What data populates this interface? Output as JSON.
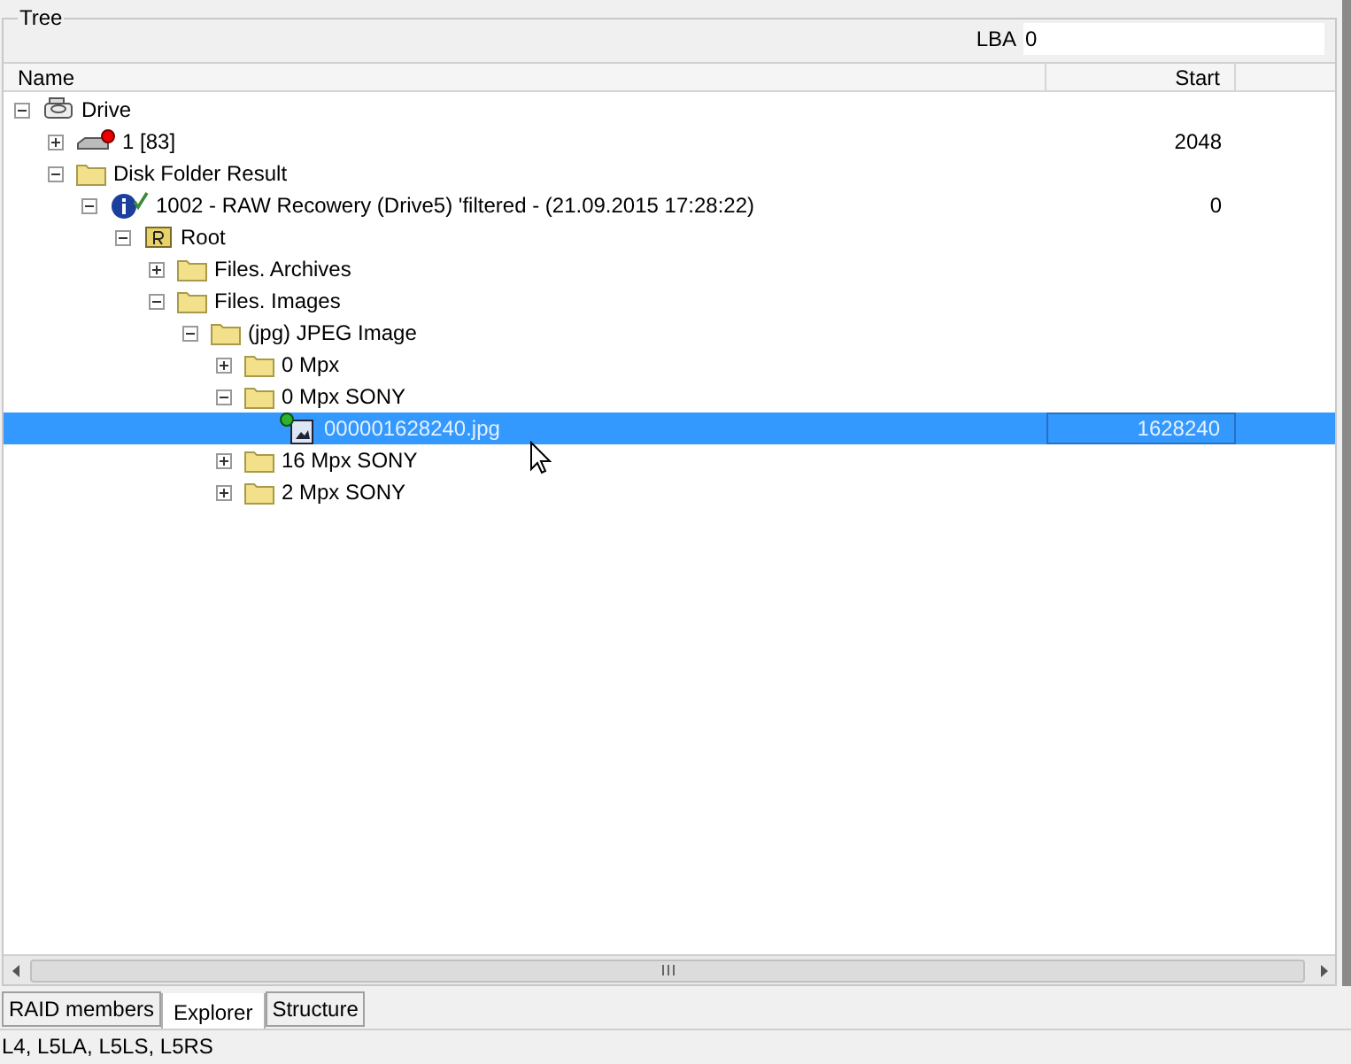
{
  "group_title": "Tree",
  "lba": {
    "label": "LBA",
    "value": "0"
  },
  "columns": [
    "Name",
    "Start"
  ],
  "tree": [
    {
      "kind": "drive",
      "name": "Drive",
      "expanded": true,
      "selected": false,
      "children": [
        {
          "kind": "disk",
          "name": "1 [83]",
          "start": "2048",
          "expanded": false,
          "selected": false
        },
        {
          "kind": "folder",
          "name": "Disk Folder Result",
          "expanded": true,
          "selected": false,
          "children": [
            {
              "kind": "info",
              "name": "1002 - RAW Recowery (Drive5) 'filtered - (21.09.2015 17:28:22)",
              "start": "0",
              "expanded": true,
              "selected": false,
              "children": [
                {
                  "kind": "root",
                  "name": "Root",
                  "expanded": true,
                  "selected": false,
                  "children": [
                    {
                      "kind": "folder",
                      "name": "Files. Archives",
                      "expanded": false,
                      "selected": false
                    },
                    {
                      "kind": "folder",
                      "name": "Files. Images",
                      "expanded": true,
                      "selected": false,
                      "children": [
                        {
                          "kind": "folder",
                          "name": "(jpg) JPEG Image",
                          "expanded": true,
                          "selected": false,
                          "children": [
                            {
                              "kind": "folder",
                              "name": "0 Mpx",
                              "expanded": false,
                              "selected": false
                            },
                            {
                              "kind": "folder",
                              "name": "0 Mpx SONY",
                              "expanded": true,
                              "selected": false,
                              "children": [
                                {
                                  "kind": "file",
                                  "name": "000001628240.jpg",
                                  "start": "1628240",
                                  "selected": true
                                }
                              ]
                            },
                            {
                              "kind": "folder",
                              "name": "16 Mpx SONY",
                              "expanded": false,
                              "selected": false
                            },
                            {
                              "kind": "folder",
                              "name": "2 Mpx SONY",
                              "expanded": false,
                              "selected": false
                            }
                          ]
                        }
                      ]
                    }
                  ]
                }
              ]
            }
          ]
        }
      ]
    }
  ],
  "tabs": [
    {
      "label": "RAID members",
      "selected": false
    },
    {
      "label": "Explorer",
      "selected": true
    },
    {
      "label": "Structure",
      "selected": false
    }
  ],
  "status_bar": "L4, L5LA, L5LS, L5RS"
}
